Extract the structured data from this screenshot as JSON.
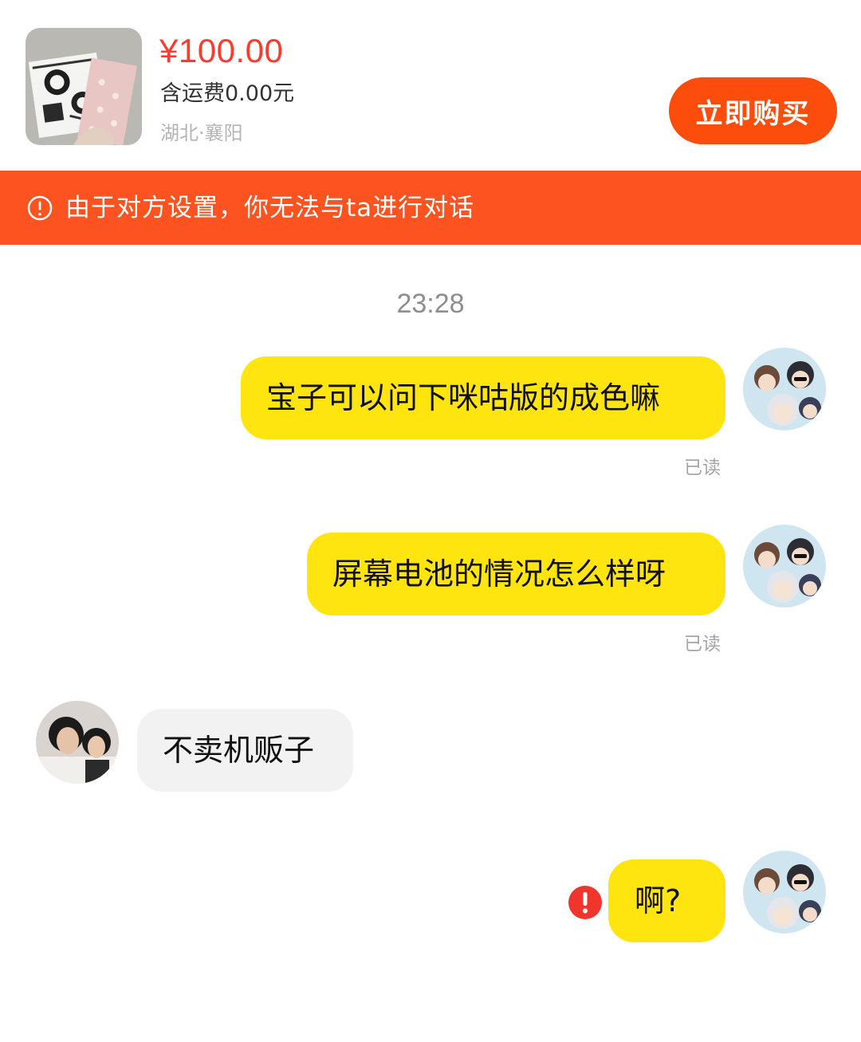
{
  "product": {
    "price": "¥100.00",
    "shipping": "含运费0.00元",
    "location": "湖北·襄阳",
    "buy_label": "立即购买"
  },
  "banner": {
    "text": "由于对方设置，你无法与ta进行对话",
    "icon": "info-circle-icon"
  },
  "chat": {
    "timestamp": "23:28",
    "messages": [
      {
        "side": "me",
        "text": "宝子可以问下咪咕版的成色嘛",
        "status": "已读"
      },
      {
        "side": "me",
        "text": "屏幕电池的情况怎么样呀",
        "status": "已读"
      },
      {
        "side": "them",
        "text": "不卖机贩子"
      },
      {
        "side": "me",
        "text": "啊?",
        "error": "send-failed-icon"
      }
    ]
  },
  "colors": {
    "price": "#ff3b30",
    "buy_button": "#fd4d0d",
    "banner": "#fd5320",
    "my_bubble": "#ffe50f",
    "their_bubble": "#f2f2f2",
    "error": "#f0362c"
  }
}
